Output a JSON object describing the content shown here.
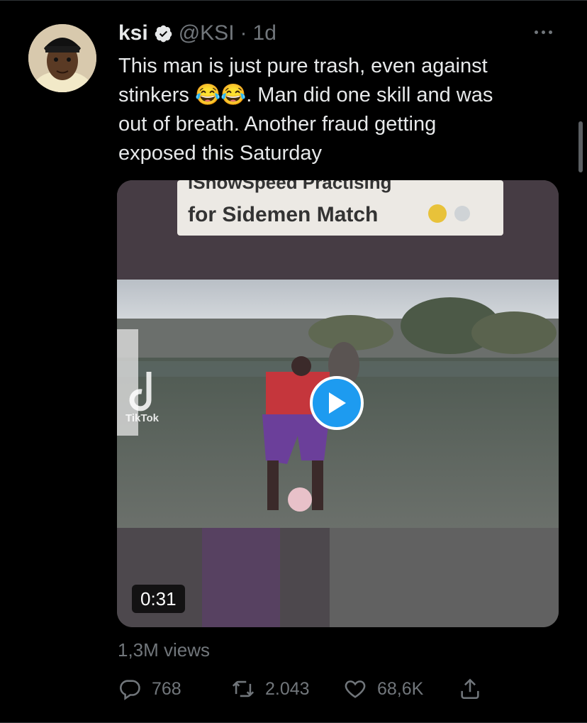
{
  "tweet": {
    "display_name": "ksi",
    "handle": "@KSI",
    "separator": "·",
    "time": "1d",
    "text": "This man is just pure trash, even against\nstinkers 😂😂. Man did one skill and was\nout of breath. Another fraud getting\nexposed this Saturday",
    "verified": true
  },
  "media": {
    "overlay_caption_top": "iShowSpeed Practising",
    "overlay_caption": "for Sidemen Match",
    "watermark": "TikTok",
    "duration": "0:31",
    "play_icon": "play-icon"
  },
  "stats": {
    "views": "1,3M views"
  },
  "actions": {
    "reply_count": "768",
    "retweet_count": "2.043",
    "like_count": "68,6K"
  },
  "colors": {
    "background": "#000000",
    "text_primary": "#e7e9ea",
    "text_secondary": "#71767b",
    "accent": "#1d9bf0"
  }
}
